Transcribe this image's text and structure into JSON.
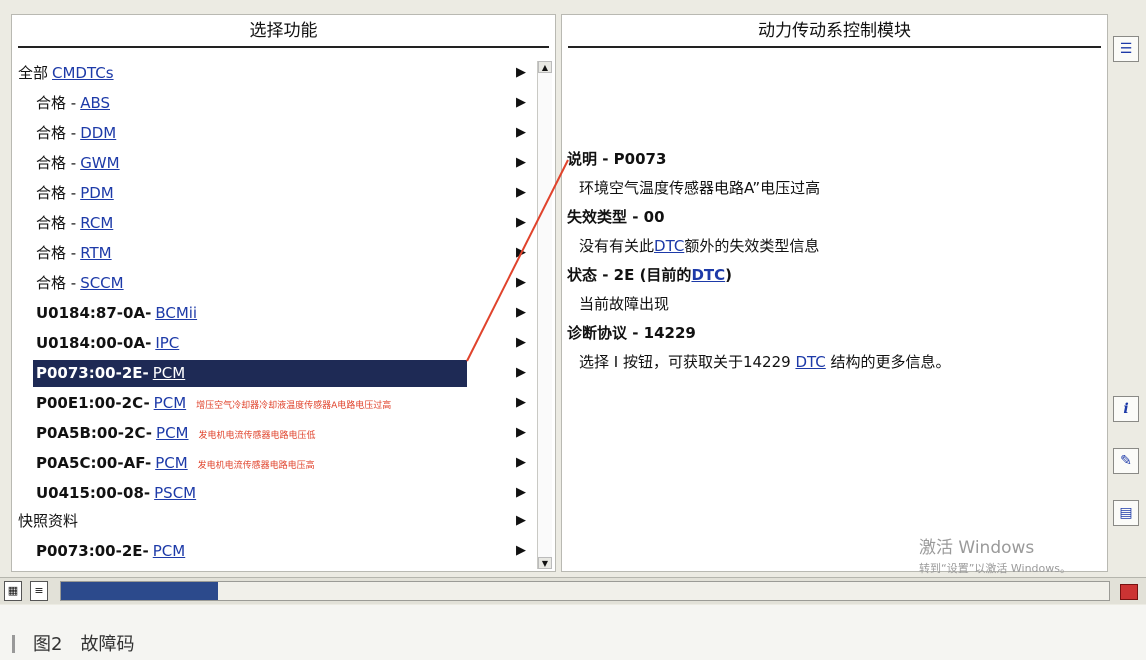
{
  "left_panel": {
    "title": "选择功能",
    "rows": [
      {
        "level": 0,
        "prefix": "全部",
        "code": "",
        "link": "CMDTCs",
        "note": ""
      },
      {
        "level": 1,
        "prefix": "合格 -",
        "code": "",
        "link": "ABS",
        "note": ""
      },
      {
        "level": 1,
        "prefix": "合格 -",
        "code": "",
        "link": "DDM",
        "note": ""
      },
      {
        "level": 1,
        "prefix": "合格 -",
        "code": "",
        "link": "GWM",
        "note": ""
      },
      {
        "level": 1,
        "prefix": "合格 -",
        "code": "",
        "link": "PDM",
        "note": ""
      },
      {
        "level": 1,
        "prefix": "合格 -",
        "code": "",
        "link": "RCM",
        "note": ""
      },
      {
        "level": 1,
        "prefix": "合格 -",
        "code": "",
        "link": "RTM",
        "note": ""
      },
      {
        "level": 1,
        "prefix": "合格 -",
        "code": "",
        "link": "SCCM",
        "note": ""
      },
      {
        "level": 1,
        "prefix": "",
        "code": "U0184:87-0A-",
        "link": "BCMii",
        "note": ""
      },
      {
        "level": 1,
        "prefix": "",
        "code": "U0184:00-0A-",
        "link": "IPC",
        "note": ""
      },
      {
        "level": 1,
        "prefix": "",
        "code": "P0073:00-2E-",
        "link": "PCM",
        "note": "",
        "selected": true
      },
      {
        "level": 1,
        "prefix": "",
        "code": "P00E1:00-2C-",
        "link": "PCM",
        "note": "增压空气冷却器冷却液温度传感器A电路电压过高"
      },
      {
        "level": 1,
        "prefix": "",
        "code": "P0A5B:00-2C-",
        "link": "PCM",
        "note": "发电机电流传感器电路电压低"
      },
      {
        "level": 1,
        "prefix": "",
        "code": "P0A5C:00-AF-",
        "link": "PCM",
        "note": "发电机电流传感器电路电压高"
      },
      {
        "level": 1,
        "prefix": "",
        "code": "U0415:00-08-",
        "link": "PSCM",
        "note": ""
      },
      {
        "level": 0,
        "prefix": "快照资料",
        "code": "",
        "link": "",
        "note": ""
      },
      {
        "level": 1,
        "prefix": "",
        "code": "P0073:00-2E-",
        "link": "PCM",
        "note": ""
      }
    ],
    "arrow_glyph": "▶"
  },
  "right_panel": {
    "title": "动力传动系控制模块",
    "lines": [
      {
        "sub": false,
        "pre": "说明 - P0073",
        "link": "",
        "post": ""
      },
      {
        "sub": true,
        "pre": "环境空气温度传感器电路A”电压过高",
        "link": "",
        "post": ""
      },
      {
        "sub": false,
        "pre": "失效类型 - 00",
        "link": "",
        "post": ""
      },
      {
        "sub": true,
        "pre": "没有有关此",
        "link": "DTC",
        "post": "额外的失效类型信息"
      },
      {
        "sub": false,
        "pre": "状态 - 2E (目前的",
        "link": "DTC",
        "post": ")"
      },
      {
        "sub": true,
        "pre": "当前故障出现",
        "link": "",
        "post": ""
      },
      {
        "sub": false,
        "pre": "诊断协议 - 14229",
        "link": "",
        "post": ""
      },
      {
        "sub": true,
        "pre": "选择 I 按钮，可获取关于14229 ",
        "link": "DTC",
        "post": " 结构的更多信息。"
      }
    ],
    "watermark": {
      "title": "激活 Windows",
      "subtitle": "转到“设置”以激活 Windows。"
    }
  },
  "side_buttons": [
    {
      "icon": "list-icon",
      "glyph": "☰"
    },
    {
      "icon": "info-icon",
      "glyph": "i"
    },
    {
      "icon": "tools-icon",
      "glyph": "✎"
    },
    {
      "icon": "document-icon",
      "glyph": "▤"
    }
  ],
  "status_bar": {
    "progress": 0.15
  },
  "caption": "图2　故障码",
  "colors": {
    "link": "#1d3aa8",
    "selected_bg": "#1e2a55",
    "note": "#e0432c",
    "pointer": "#e0432c"
  }
}
